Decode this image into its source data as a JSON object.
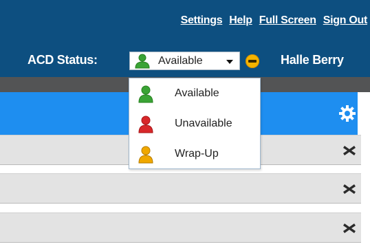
{
  "header": {
    "links": [
      "Settings",
      "Help",
      "Full Screen",
      "Sign Out"
    ],
    "acd_label": "ACD Status:",
    "selected_status": "Available",
    "user_name": "Halle Berry"
  },
  "status_menu": {
    "options": [
      {
        "label": "Available",
        "icon": "person-green-icon",
        "color": "#3aa335"
      },
      {
        "label": "Unavailable",
        "icon": "person-red-icon",
        "color": "#d8282a"
      },
      {
        "label": "Wrap-Up",
        "icon": "person-yellow-icon",
        "color": "#f0a800"
      }
    ]
  },
  "colors": {
    "header_bg": "#0d4f80",
    "band_bg": "#535455",
    "panel_bg": "#1e8ef0",
    "row_bg": "#e3e3e3",
    "status_dot": "#f5b400"
  }
}
